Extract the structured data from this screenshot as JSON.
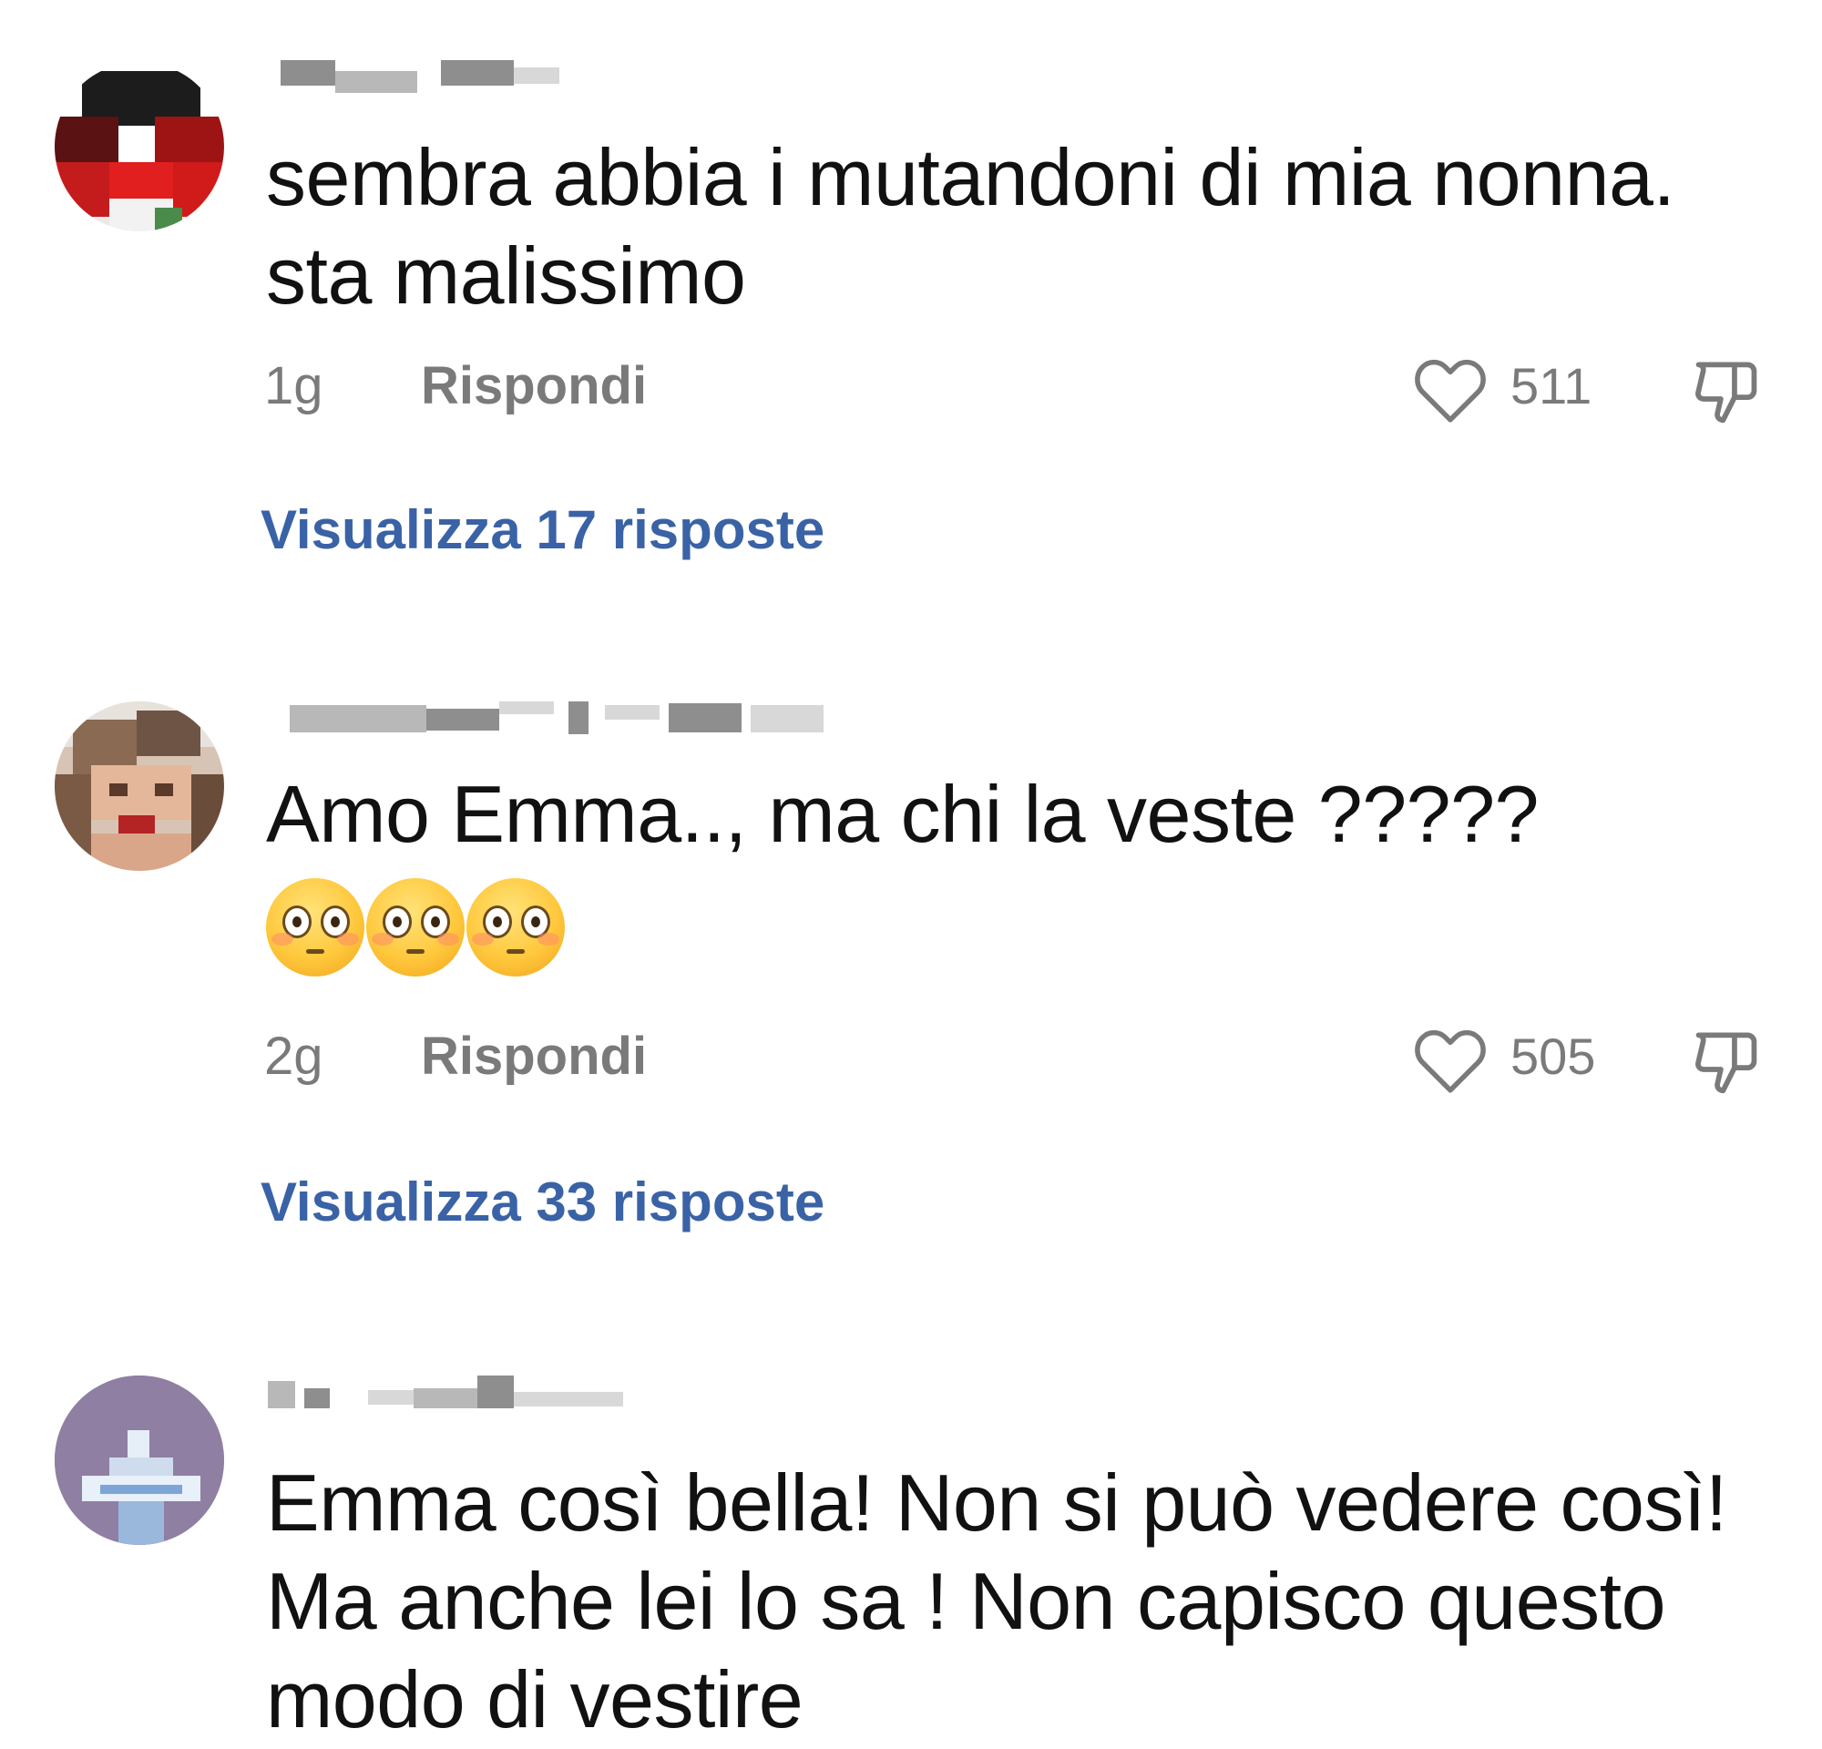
{
  "comments": [
    {
      "text": "sembra abbia i mutandoni di mia nonna. sta malissimo",
      "time": "1g",
      "reply_label": "Rispondi",
      "likes": "511",
      "view_replies": "Visualizza 17 risposte",
      "emojis": []
    },
    {
      "text": "Amo Emma.., ma chi la veste ?????",
      "time": "2g",
      "reply_label": "Rispondi",
      "likes": "505",
      "view_replies": "Visualizza 33 risposte",
      "emojis": [
        "flushed-face",
        "flushed-face",
        "flushed-face"
      ]
    },
    {
      "text": "Emma così bella! Non si può vedere così! Ma anche lei lo sa ! Non capisco questo modo di vestire"
    }
  ],
  "icons": {
    "like": "heart-outline-icon",
    "dislike": "thumbs-down-outline-icon"
  },
  "colors": {
    "text": "#111111",
    "muted": "#7a7a7a",
    "link": "#3a62a6",
    "background": "#ffffff"
  }
}
